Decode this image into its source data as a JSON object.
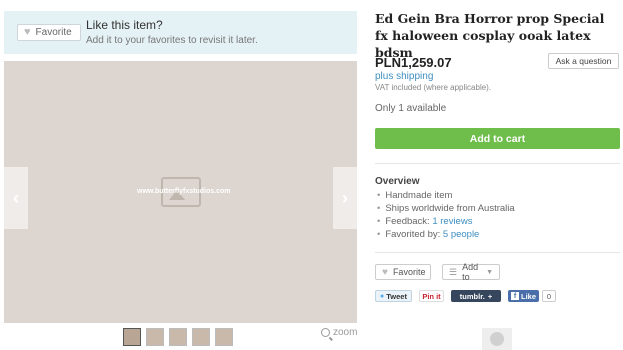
{
  "favorite_banner": {
    "button_label": "Favorite",
    "title": "Like this item?",
    "subtitle": "Add it to your favorites to revisit it later."
  },
  "viewer": {
    "watermark": "www.butterflyfxstudios.com",
    "zoom_label": "zoom",
    "thumbnail_count": 5,
    "active_thumbnail": 1
  },
  "listing": {
    "title": "Ed Gein Bra Horror prop Special fx haloween cosplay ooak latex bdsm",
    "price": "PLN1,259.07",
    "ask_label": "Ask a question",
    "shipping": "plus shipping",
    "vat": "VAT included (where applicable).",
    "availability": "Only 1 available",
    "cart_label": "Add to cart"
  },
  "overview": {
    "title": "Overview",
    "items": [
      {
        "text": "Handmade item"
      },
      {
        "text": "Ships worldwide from Australia"
      },
      {
        "text": "Feedback: ",
        "link": "1 reviews"
      },
      {
        "text": "Favorited by: ",
        "link": "5 people"
      }
    ]
  },
  "actions": {
    "favorite_label": "Favorite",
    "add_to_label": "Add to"
  },
  "share": {
    "tweet": "Tweet",
    "pin": "Pin it",
    "tumblr": "tumblr.",
    "tumblr_plus": "+",
    "fb_like": "Like",
    "fb_count": "0"
  },
  "colors": {
    "banner_bg": "#e4f1f5",
    "link": "#3e8ebf",
    "cart": "#6fbd4b",
    "tumblr": "#36465d",
    "facebook": "#4a6ea9"
  }
}
